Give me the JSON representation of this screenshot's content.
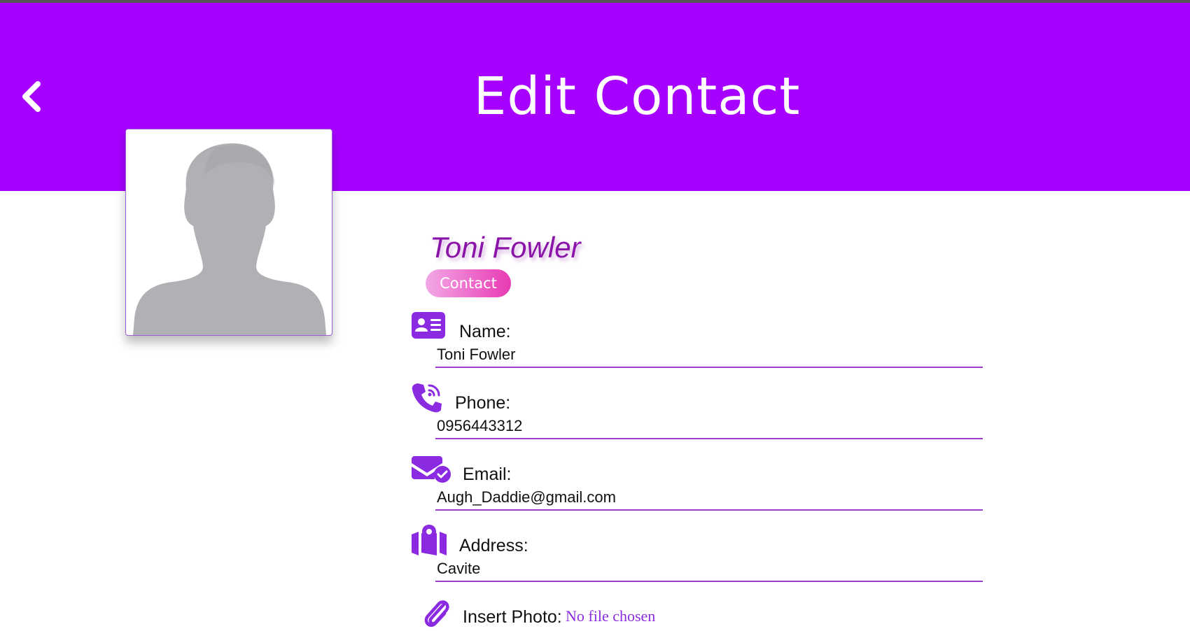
{
  "header": {
    "title": "Edit Contact",
    "back_icon": "chevron-left-icon",
    "background": "#a600ff"
  },
  "profile": {
    "avatar_icon": "person-silhouette-icon",
    "name": "Toni Fowler",
    "badge": "Contact"
  },
  "form": {
    "name_label": "Name:",
    "name_value": "Toni Fowler",
    "name_icon": "address-card-icon",
    "phone_label": "Phone:",
    "phone_value": "0956443312",
    "phone_icon": "phone-volume-icon",
    "email_label": "Email:",
    "email_value": "Augh_Daddie@gmail.com",
    "email_icon": "envelope-check-icon",
    "address_label": "Address:",
    "address_value": "Cavite",
    "address_icon": "map-location-icon",
    "photo_label": "Insert Photo:",
    "photo_status": "No file chosen",
    "photo_icon": "paperclip-icon"
  },
  "colors": {
    "accent": "#a600ff",
    "icon": "#8a2be2",
    "name_text": "#8a14a8",
    "badge_start": "#f3a8e6",
    "badge_end": "#e83ab3"
  }
}
